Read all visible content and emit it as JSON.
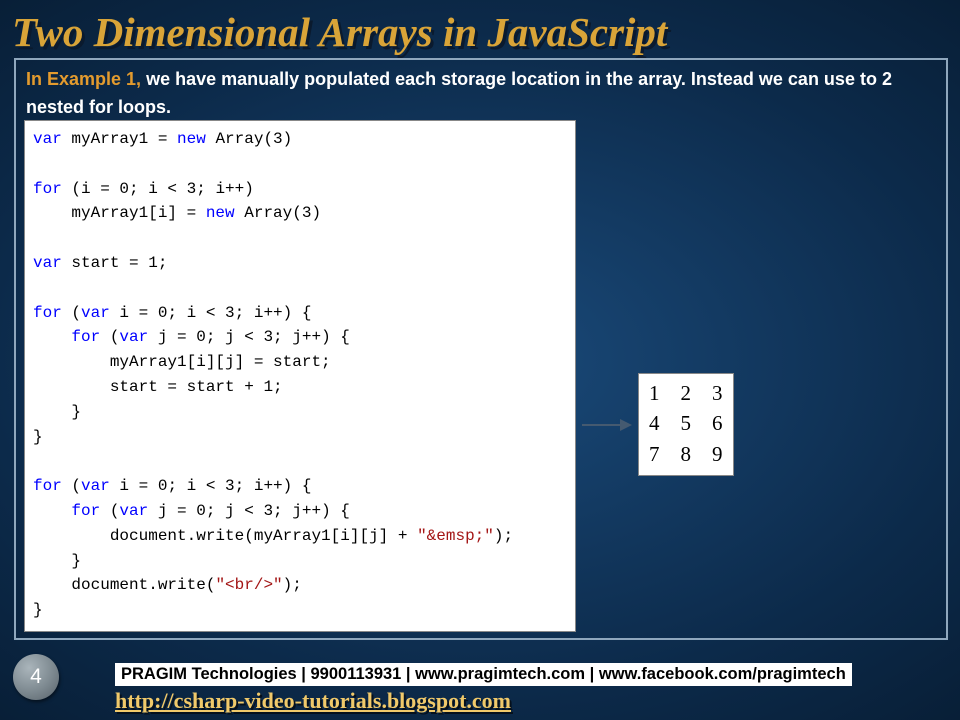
{
  "slide": {
    "title": "Two Dimensional Arrays in JavaScript",
    "intro_highlight": "In Example 1, ",
    "intro_rest": "we have manually populated each storage location in the array. Instead we can use to 2 nested for loops.",
    "page_number": "4"
  },
  "code": {
    "l1a": "var",
    "l1b": " myArray1 = ",
    "l1c": "new",
    "l1d": " Array(3)",
    "l2a": "for",
    "l2b": " (i = 0; i < 3; i++)",
    "l3a": "    myArray1[i] = ",
    "l3b": "new",
    "l3c": " Array(3)",
    "l4a": "var",
    "l4b": " start = 1;",
    "l5a": "for",
    "l5b": " (",
    "l5c": "var",
    "l5d": " i = 0; i < 3; i++) {",
    "l6a": "    ",
    "l6b": "for",
    "l6c": " (",
    "l6d": "var",
    "l6e": " j = 0; j < 3; j++) {",
    "l7": "        myArray1[i][j] = start;",
    "l8": "        start = start + 1;",
    "l9": "    }",
    "l10": "}",
    "l11a": "for",
    "l11b": " (",
    "l11c": "var",
    "l11d": " i = 0; i < 3; i++) {",
    "l12a": "    ",
    "l12b": "for",
    "l12c": " (",
    "l12d": "var",
    "l12e": " j = 0; j < 3; j++) {",
    "l13a": "        document.write(myArray1[i][j] + ",
    "l13b": "\"&emsp;\"",
    "l13c": ");",
    "l14": "    }",
    "l15a": "    document.write(",
    "l15b": "\"<br/>\"",
    "l15c": ");",
    "l16": "}"
  },
  "output": {
    "r1": "1    2    3",
    "r2": "4    5    6",
    "r3": "7    8    9"
  },
  "footer": {
    "line1": "PRAGIM Technologies | 9900113931 | www.pragimtech.com | www.facebook.com/pragimtech",
    "line2": "http://csharp-video-tutorials.blogspot.com"
  }
}
